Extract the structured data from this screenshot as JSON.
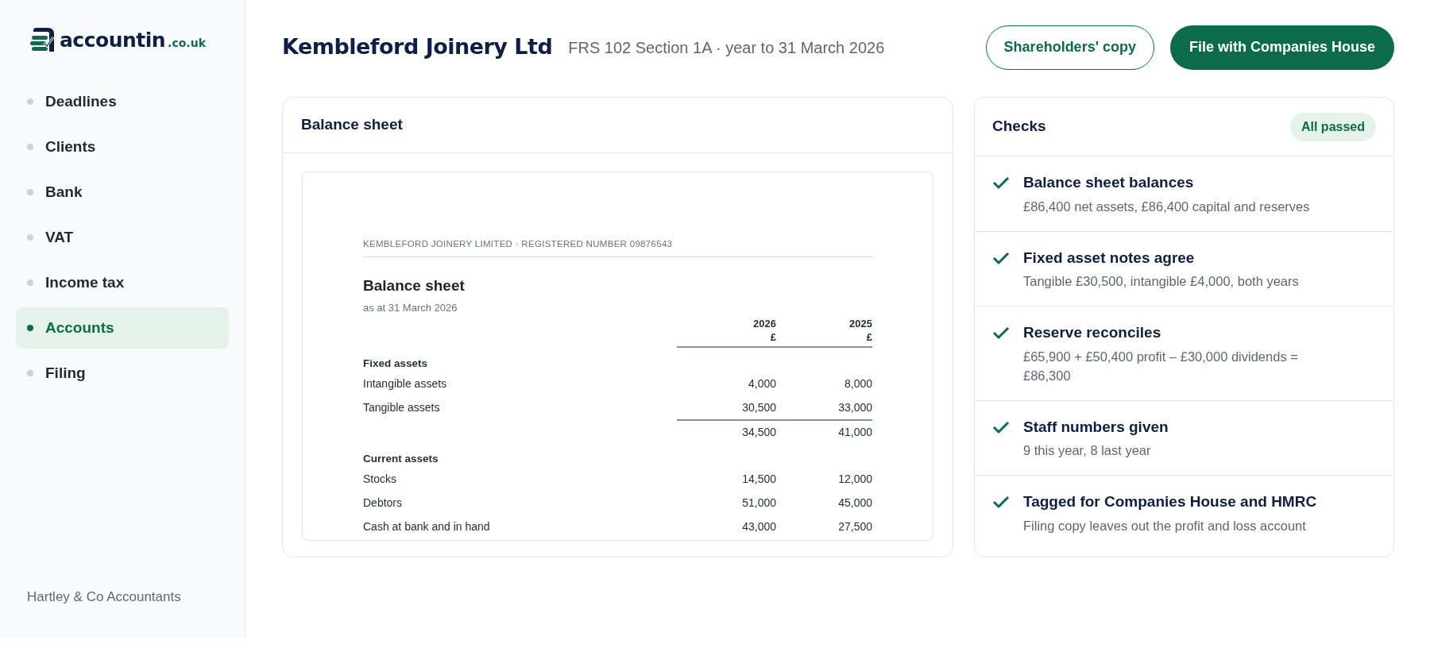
{
  "brand": {
    "name": "accountin",
    "suffix": ".co.uk"
  },
  "sidebar": {
    "items": [
      {
        "label": "Deadlines",
        "selected": false
      },
      {
        "label": "Clients",
        "selected": false
      },
      {
        "label": "Bank",
        "selected": false
      },
      {
        "label": "VAT",
        "selected": false
      },
      {
        "label": "Income tax",
        "selected": false
      },
      {
        "label": "Accounts",
        "selected": true
      },
      {
        "label": "Filing",
        "selected": false
      }
    ],
    "footer": "Hartley & Co Accountants"
  },
  "header": {
    "title": "Kembleford Joinery Ltd",
    "subtitle": "FRS 102 Section 1A · year to 31 March 2026",
    "buttons": [
      {
        "label": "Shareholders' copy",
        "kind": "secondary"
      },
      {
        "label": "File with Companies House",
        "kind": "primary"
      }
    ]
  },
  "balance_sheet": {
    "title": "Balance sheet",
    "document": {
      "company_line": "KEMBLEFORD JOINERY LIMITED · REGISTERED NUMBER 09876543",
      "title": "Balance sheet",
      "date": "as at 31 March 2026",
      "columns": [
        {
          "year": "2026",
          "unit": "£"
        },
        {
          "year": "2025",
          "unit": "£"
        }
      ],
      "rows": [
        {
          "kind": "heading",
          "label": "Fixed assets"
        },
        {
          "kind": "line",
          "label": "Intangible assets",
          "values": [
            "4,000",
            "8,000"
          ]
        },
        {
          "kind": "line",
          "label": "Tangible assets",
          "values": [
            "30,500",
            "33,000"
          ]
        },
        {
          "kind": "total",
          "values": [
            "34,500",
            "41,000"
          ]
        },
        {
          "kind": "heading",
          "label": "Current assets"
        },
        {
          "kind": "line",
          "label": "Stocks",
          "values": [
            "14,500",
            "12,000"
          ]
        },
        {
          "kind": "line",
          "label": "Debtors",
          "values": [
            "51,000",
            "45,000"
          ]
        },
        {
          "kind": "line",
          "label": "Cash at bank and in hand",
          "values": [
            "43,000",
            "27,500"
          ]
        }
      ]
    }
  },
  "checks": {
    "title": "Checks",
    "badge": "All passed",
    "items": [
      {
        "title": "Balance sheet balances",
        "detail": "£86,400 net assets, £86,400 capital and reserves",
        "passed": true
      },
      {
        "title": "Fixed asset notes agree",
        "detail": "Tangible £30,500, intangible £4,000, both years",
        "passed": true
      },
      {
        "title": "Reserve reconciles",
        "detail": "£65,900 + £50,400 profit – £30,000 dividends = £86,300",
        "passed": true
      },
      {
        "title": "Staff numbers given",
        "detail": "9 this year, 8 last year",
        "passed": true
      },
      {
        "title": "Tagged for Companies House and HMRC",
        "detail": "Filing copy leaves out the profit and loss account",
        "passed": true
      }
    ]
  }
}
